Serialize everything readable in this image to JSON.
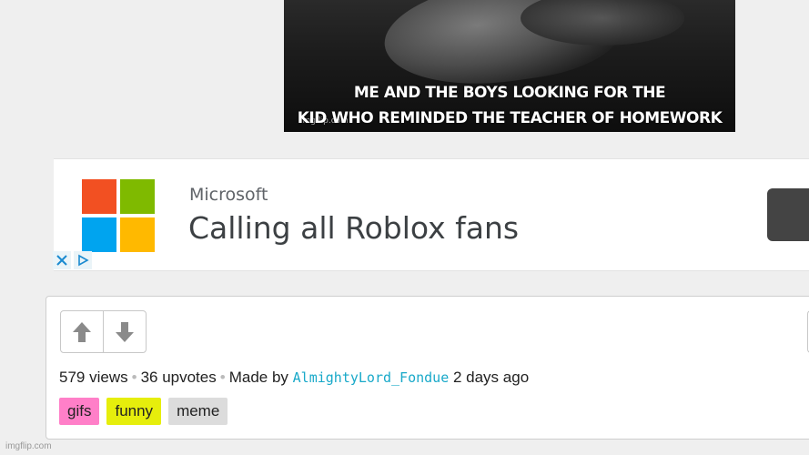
{
  "meme": {
    "caption_line1": "ME AND THE BOYS LOOKING FOR THE",
    "caption_line2": "KID WHO REMINDED THE TEACHER OF HOMEWORK",
    "watermark": "imgflip.com"
  },
  "ad": {
    "brand": "Microsoft",
    "headline": "Calling all Roblox fans",
    "logo_colors": [
      "#f25022",
      "#7fba00",
      "#00a4ef",
      "#ffb900"
    ]
  },
  "post": {
    "views": "579 views",
    "upvotes": "36 upvotes",
    "made_by": "Made by",
    "author": "AlmightyLord_Fondue",
    "time": "2 days ago",
    "tags": [
      {
        "label": "gifs",
        "color": "#ff7fc8"
      },
      {
        "label": "funny",
        "color": "#e6ee0c"
      },
      {
        "label": "meme",
        "color": "#dcdcdc"
      }
    ]
  },
  "site_watermark": "imgflip.com"
}
